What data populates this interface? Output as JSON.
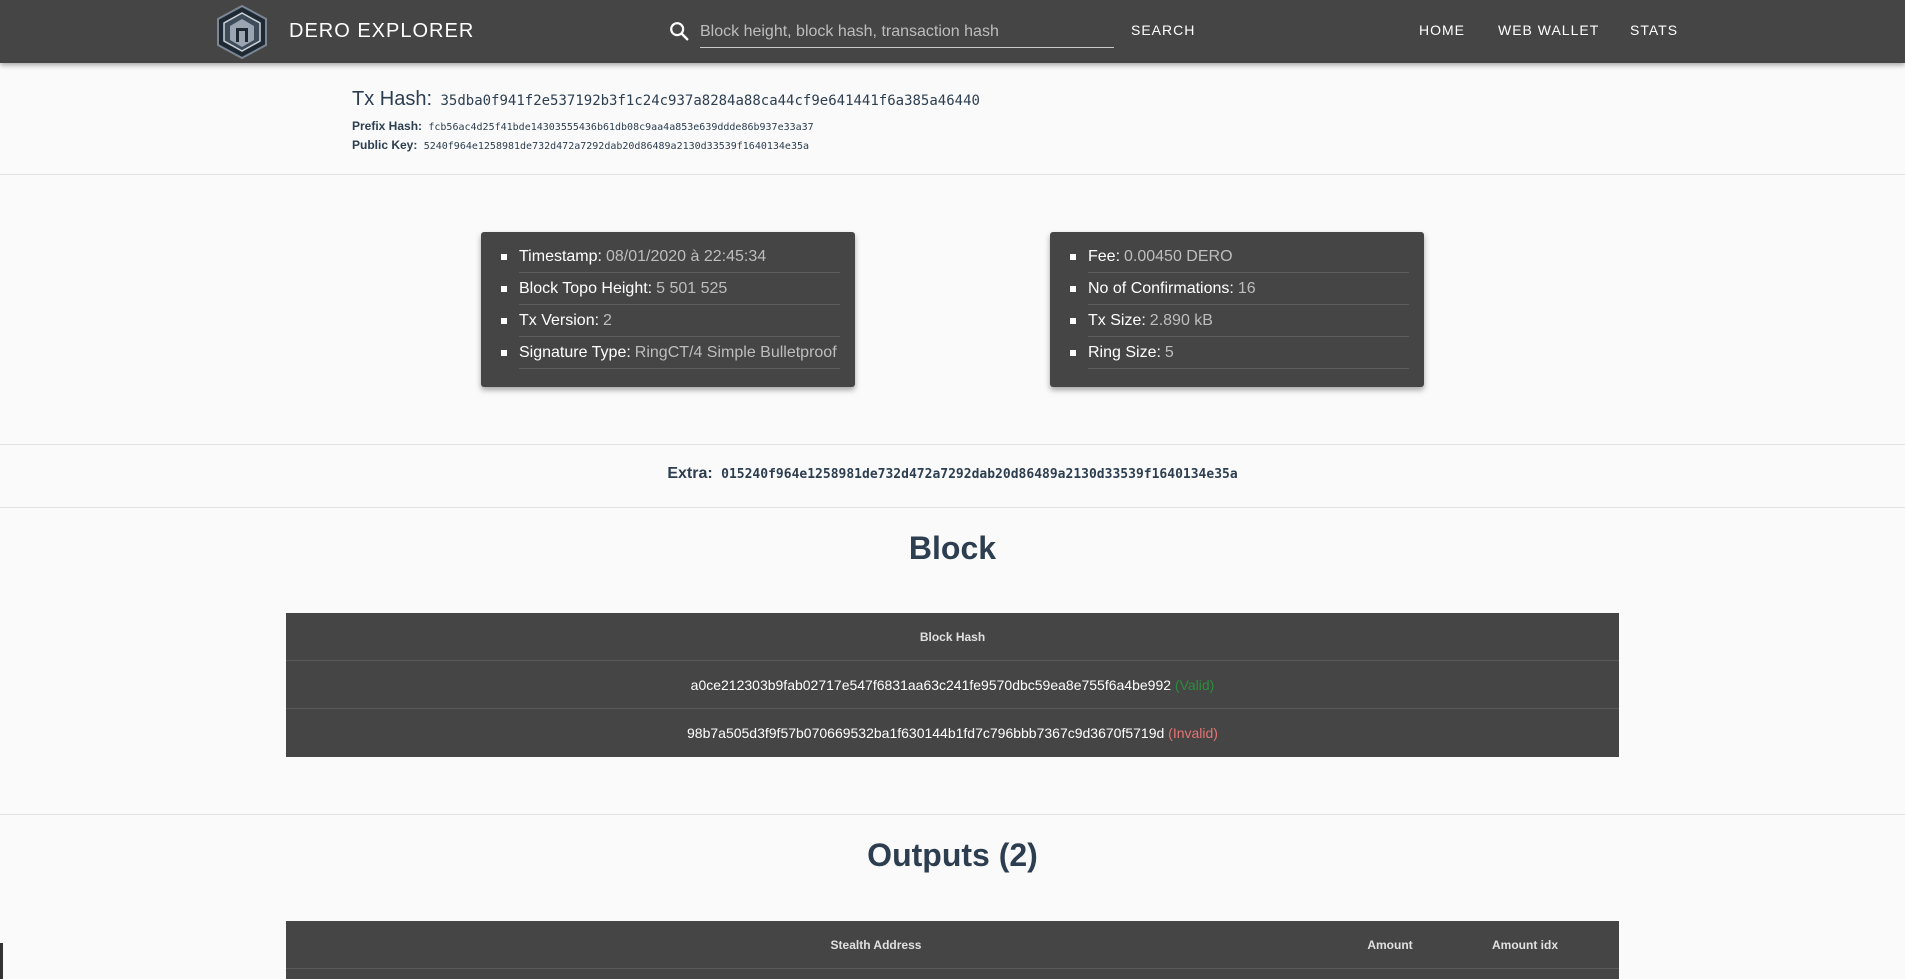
{
  "navbar": {
    "brand": "DERO EXPLORER",
    "search_placeholder": "Block height, block hash, transaction hash",
    "search_button": "SEARCH",
    "links": [
      "HOME",
      "WEB WALLET",
      "STATS"
    ]
  },
  "tx": {
    "hash_label": "Tx Hash:",
    "hash": "35dba0f941f2e537192b3f1c24c937a8284a88ca44cf9e641441f6a385a46440",
    "prefix_label": "Prefix Hash:",
    "prefix": "fcb56ac4d25f41bde14303555436b61db08c9aa4a853e639ddde86b937e33a37",
    "pubkey_label": "Public Key:",
    "pubkey": "5240f964e1258981de732d472a7292dab20d86489a2130d33539f1640134e35a"
  },
  "left_card": [
    {
      "label": "Timestamp:",
      "value": "08/01/2020 à 22:45:34"
    },
    {
      "label": "Block Topo Height:",
      "value": "5 501 525"
    },
    {
      "label": "Tx Version:",
      "value": "2"
    },
    {
      "label": "Signature Type:",
      "value": "RingCT/4 Simple Bulletproof"
    }
  ],
  "right_card": [
    {
      "label": "Fee:",
      "value": "0.00450 DERO"
    },
    {
      "label": "No of Confirmations:",
      "value": "16"
    },
    {
      "label": "Tx Size:",
      "value": "2.890 kB"
    },
    {
      "label": "Ring Size:",
      "value": "5"
    }
  ],
  "extra": {
    "label": "Extra:",
    "value": "015240f964e1258981de732d472a7292dab20d86489a2130d33539f1640134e35a"
  },
  "block_section": {
    "title": "Block",
    "header": "Block Hash",
    "rows": [
      {
        "hash": "a0ce212303b9fab02717e547f6831aa63c241fe9570dbc59ea8e755f6a4be992",
        "status": "(Valid)"
      },
      {
        "hash": "98b7a505d3f9f57b070669532ba1f630144b1fd7c796bbb7367c9d3670f5719d",
        "status": "(Invalid)"
      }
    ]
  },
  "outputs_section": {
    "title": "Outputs (2)",
    "headers": [
      "Stealth Address",
      "Amount",
      "Amount idx"
    ]
  },
  "colors": {
    "navbar": "#454545",
    "card": "#454545",
    "valid": "#2e8b3e",
    "invalid": "#e57373",
    "text": "#2c3e50"
  }
}
